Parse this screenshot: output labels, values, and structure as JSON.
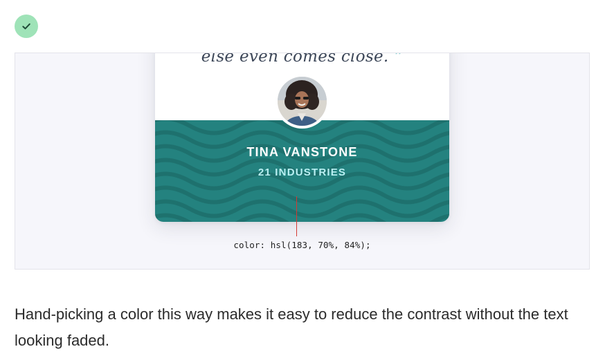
{
  "status": {
    "icon": "checkmark-icon",
    "accent_color": "#9fe3b8"
  },
  "demo": {
    "quote_fragment": "else even comes close.",
    "quote_mark": "”",
    "author_name": "TINA VANSTONE",
    "author_company": "21 INDUSTRIES",
    "band_color": "#24827f",
    "company_color": "hsl(183, 70%, 84%)",
    "annotation": "color: hsl(183, 70%, 84%);",
    "pointer_color": "#d43a33"
  },
  "caption": {
    "text": "Hand-picking a color this way makes it easy to reduce the contrast without the text looking faded."
  }
}
